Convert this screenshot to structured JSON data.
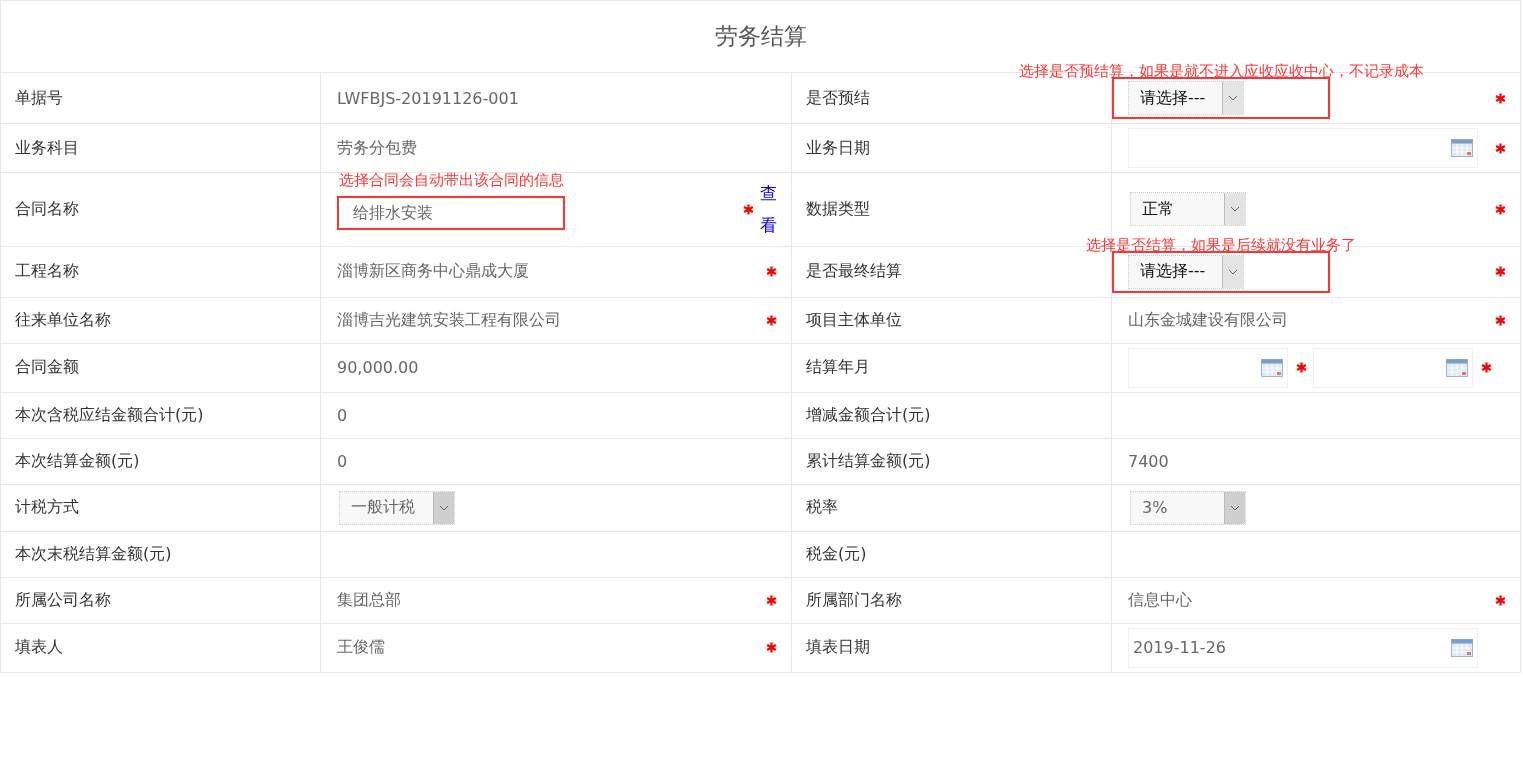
{
  "title": "劳务结算",
  "rows": [
    {
      "left": {
        "label": "单据号",
        "kind": "text",
        "value": "LWFBJS-20191126-001",
        "required": false
      },
      "right": {
        "label": "是否预结",
        "kind": "select",
        "value": "请选择---",
        "disabled": false,
        "required": true,
        "highlighted": true,
        "note": "选择是否预结算，如果是就不进入应收应收中心，不记录成本"
      }
    },
    {
      "left": {
        "label": "业务科目",
        "kind": "text",
        "value": "劳务分包费",
        "required": false
      },
      "right": {
        "label": "业务日期",
        "kind": "date",
        "required": true
      }
    },
    {
      "left": {
        "label": "合同名称",
        "kind": "input",
        "value": "给排水安装",
        "required": true,
        "highlighted": true,
        "note": "选择合同会自动带出该合同的信息",
        "link": "查看"
      },
      "right": {
        "label": "数据类型",
        "kind": "select",
        "value": "正常",
        "disabled": false,
        "required": true
      }
    },
    {
      "left": {
        "label": "工程名称",
        "kind": "text",
        "value": "淄博新区商务中心鼎成大厦",
        "required": true
      },
      "right": {
        "label": "是否最终结算",
        "kind": "select",
        "value": "请选择---",
        "disabled": false,
        "required": true,
        "highlighted": true,
        "note": "选择是否结算，如果是后续就没有业务了"
      }
    },
    {
      "left": {
        "label": "往来单位名称",
        "kind": "text",
        "value": "淄博吉光建筑安装工程有限公司",
        "required": true
      },
      "right": {
        "label": "项目主体单位",
        "kind": "text",
        "value": "山东金城建设有限公司",
        "required": true
      }
    },
    {
      "left": {
        "label": "合同金额",
        "kind": "text",
        "value": "90,000.00",
        "required": false
      },
      "right": {
        "label": "结算年月",
        "kind": "date_pair",
        "dates": [
          {
            "required": true
          },
          {
            "required": true
          }
        ]
      }
    },
    {
      "left": {
        "label": "本次含税应结金额合计(元)",
        "kind": "text",
        "value": "0",
        "required": false
      },
      "right": {
        "label": "增减金额合计(元)",
        "kind": "empty"
      }
    },
    {
      "left": {
        "label": "本次结算金额(元)",
        "kind": "text",
        "value": "0",
        "required": false
      },
      "right": {
        "label": "累计结算金额(元)",
        "kind": "text",
        "value": "7400",
        "required": false
      }
    },
    {
      "left": {
        "label": "计税方式",
        "kind": "select",
        "value": "一般计税",
        "disabled": true,
        "required": false
      },
      "right": {
        "label": "税率",
        "kind": "select",
        "value": "3%",
        "disabled": true,
        "required": false
      }
    },
    {
      "left": {
        "label": "本次末税结算金额(元)",
        "kind": "empty"
      },
      "right": {
        "label": "税金(元)",
        "kind": "empty"
      }
    },
    {
      "left": {
        "label": "所属公司名称",
        "kind": "text",
        "value": "集团总部",
        "required": true
      },
      "right": {
        "label": "所属部门名称",
        "kind": "text",
        "value": "信息中心",
        "required": true
      }
    },
    {
      "left": {
        "label": "填表人",
        "kind": "text",
        "value": "王俊儒",
        "required": true
      },
      "right": {
        "label": "填表日期",
        "kind": "date",
        "value": "2019-11-26",
        "required": false
      }
    }
  ]
}
